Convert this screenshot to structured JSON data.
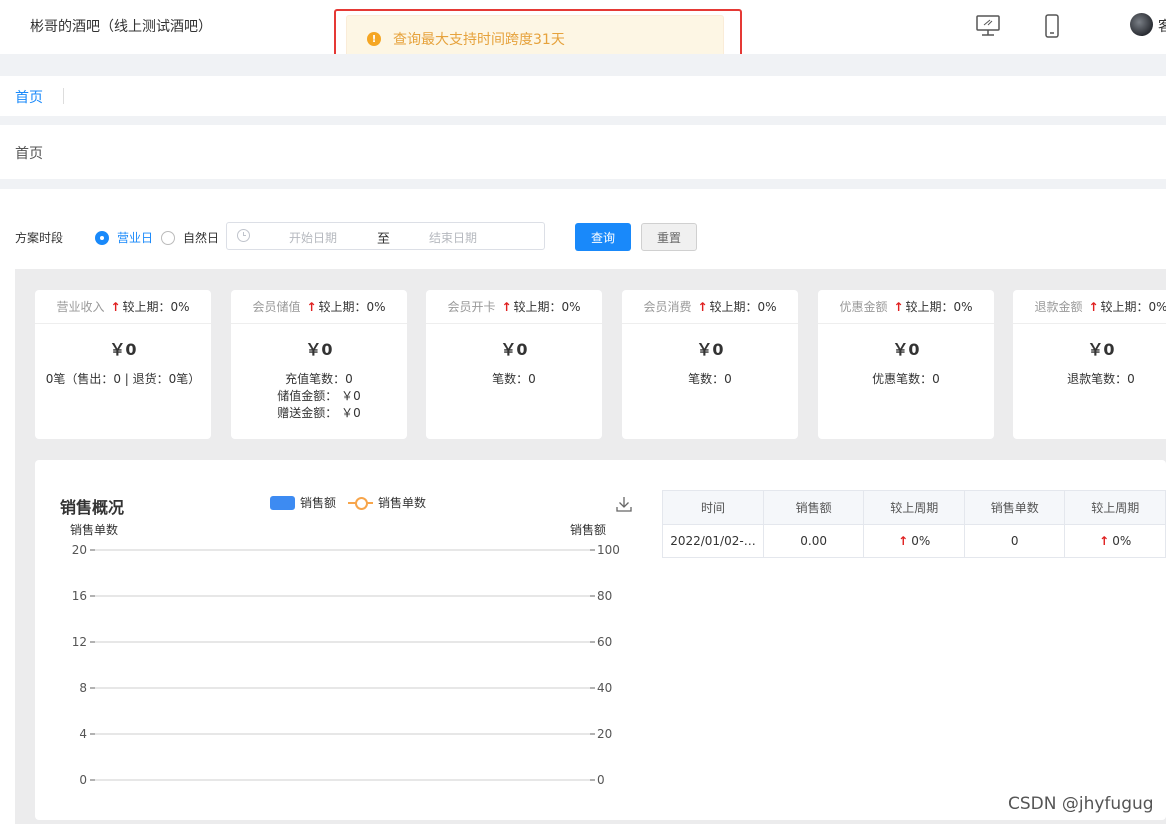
{
  "header": {
    "title": "彬哥的酒吧（线上测试酒吧）",
    "user_initial": "客"
  },
  "toast": {
    "message": "查询最大支持时间跨度31天",
    "color": "#e6a23c"
  },
  "tabs": [
    {
      "label": "首页",
      "active": true
    }
  ],
  "breadcrumb": "首页",
  "filter": {
    "label": "方案时段",
    "options": [
      {
        "label": "营业日",
        "selected": true
      },
      {
        "label": "自然日",
        "selected": false
      }
    ],
    "start_placeholder": "开始日期",
    "separator": "至",
    "end_placeholder": "结束日期",
    "query_label": "查询",
    "reset_label": "重置"
  },
  "cards": [
    {
      "label": "营业收入",
      "compare": "较上期：0%",
      "value": "￥0",
      "details": [
        "0笔（售出：0 | 退货：0笔）"
      ]
    },
    {
      "label": "会员储值",
      "compare": "较上期：0%",
      "value": "￥0",
      "details": [
        "充值笔数：0",
        "储值金额： ￥0",
        "赠送金额： ￥0"
      ]
    },
    {
      "label": "会员开卡",
      "compare": "较上期：0%",
      "value": "￥0",
      "details": [
        "笔数：0"
      ]
    },
    {
      "label": "会员消费",
      "compare": "较上期：0%",
      "value": "￥0",
      "details": [
        "笔数：0"
      ]
    },
    {
      "label": "优惠金额",
      "compare": "较上期：0%",
      "value": "￥0",
      "details": [
        "优惠笔数：0"
      ]
    },
    {
      "label": "退款金额",
      "compare": "较上期：0%",
      "value": "￥0",
      "details": [
        "退款笔数：0"
      ]
    }
  ],
  "sales": {
    "title": "销售概况",
    "legend": [
      "销售额",
      "销售单数"
    ],
    "left_axis_name": "销售单数",
    "right_axis_name": "销售额"
  },
  "chart_data": {
    "type": "line",
    "title": "销售概况",
    "series": [
      {
        "name": "销售额",
        "axis": "right",
        "values": []
      },
      {
        "name": "销售单数",
        "axis": "left",
        "values": []
      }
    ],
    "y_left": {
      "label": "销售单数",
      "ylim": [
        0,
        20
      ],
      "ticks": [
        0,
        4,
        8,
        12,
        16,
        20
      ]
    },
    "y_right": {
      "label": "销售额",
      "ylim": [
        0,
        100
      ],
      "ticks": [
        0,
        20,
        40,
        60,
        80,
        100
      ]
    },
    "grid": true,
    "legend_position": "top"
  },
  "table": {
    "headers": [
      "时间",
      "销售额",
      "较上周期",
      "销售单数",
      "较上周期"
    ],
    "rows": [
      [
        "2022/01/02-…",
        "0.00",
        "0%",
        "0",
        "0%"
      ]
    ]
  },
  "watermark": "CSDN @jhyfugug",
  "colors": {
    "primary": "#1989fa",
    "bar": "#3d8bf2",
    "line": "#f7a54b",
    "up_arrow": "#e02020"
  }
}
